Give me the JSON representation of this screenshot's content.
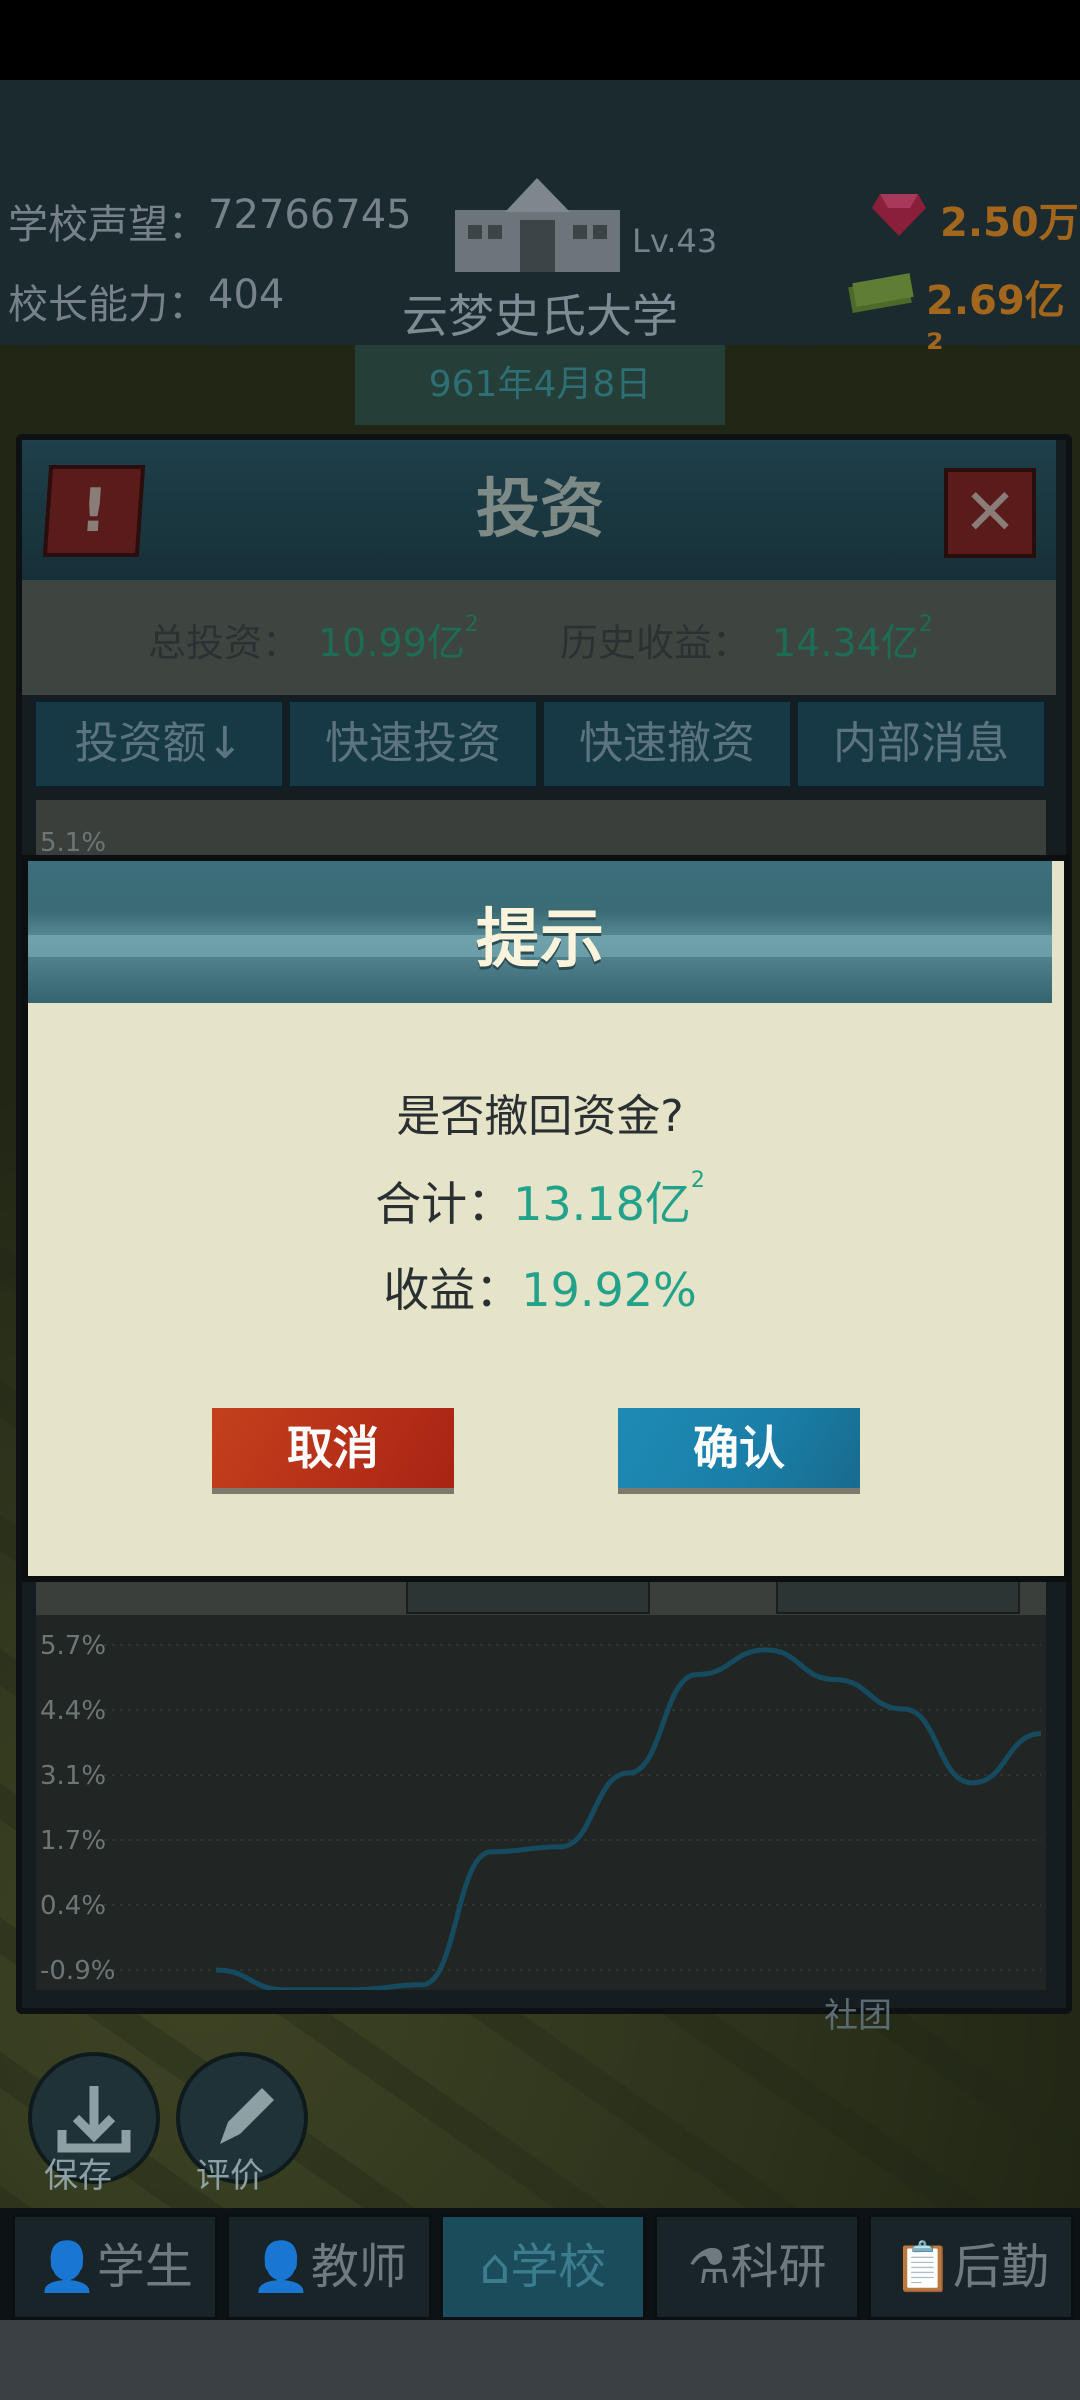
{
  "hud": {
    "reputation_label": "学校声望：",
    "reputation_value": "72766745",
    "ability_label": "校长能力：",
    "ability_value": "404",
    "level": "Lv.43",
    "school_name": "云梦史氏大学",
    "date": "961年4月8日",
    "gems": "2.50万",
    "money": "2.69亿²"
  },
  "investment_panel": {
    "title": "投资",
    "alert_icon": "!",
    "close_icon": "✕",
    "total_label": "总投资：",
    "total_value": "10.99亿",
    "total_sup": "2",
    "history_label": "历史收益：",
    "history_value": "14.34亿",
    "history_sup": "2",
    "tabs": [
      "投资额↓",
      "快速投资",
      "快速撤资",
      "内部消息"
    ],
    "top_tick": "5.1%"
  },
  "chart_data": {
    "type": "line",
    "y_ticks": [
      "5.7%",
      "4.4%",
      "3.1%",
      "1.7%",
      "0.4%",
      "-0.9%"
    ],
    "ylim": [
      -0.9,
      5.7
    ],
    "series": [
      {
        "values": [
          -0.9,
          -1.3,
          -1.3,
          -1.2,
          1.5,
          1.6,
          3.1,
          5.1,
          5.6,
          5.0,
          4.4,
          2.9,
          3.9
        ]
      }
    ],
    "color": "#164a5e"
  },
  "dialog": {
    "title": "提示",
    "question": "是否撤回资金?",
    "total_label": "合计：",
    "total_value": "13.18亿",
    "total_sup": "2",
    "profit_label": "收益：",
    "profit_value": "19.92%",
    "cancel_label": "取消",
    "confirm_label": "确认"
  },
  "bottom": {
    "save_label": "保存",
    "rate_label": "评价",
    "club_label": "社团"
  },
  "nav": [
    {
      "label": "学生",
      "icon": "student-icon"
    },
    {
      "label": "教师",
      "icon": "teacher-icon"
    },
    {
      "label": "学校",
      "icon": "school-icon",
      "active": true
    },
    {
      "label": "科研",
      "icon": "flask-icon"
    },
    {
      "label": "后勤",
      "icon": "clipboard-icon"
    }
  ]
}
